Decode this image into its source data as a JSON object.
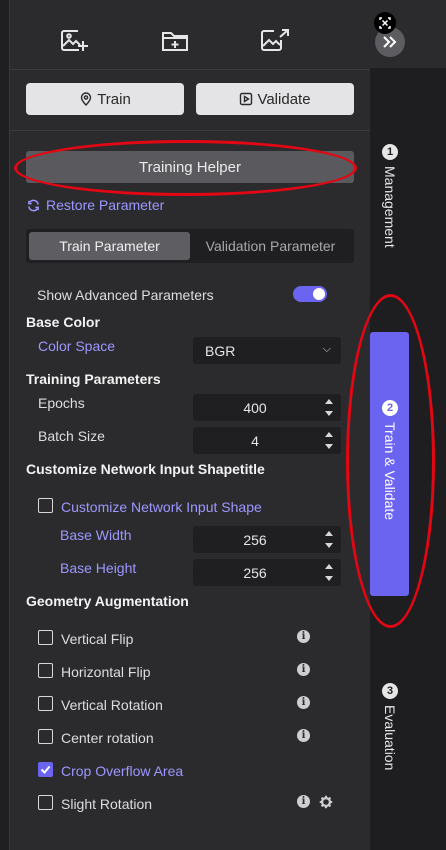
{
  "toolbar": {
    "icons": [
      "add-image-icon",
      "add-folder-icon",
      "export-image-icon"
    ]
  },
  "actions": {
    "train_label": "Train",
    "validate_label": "Validate"
  },
  "helper": {
    "label": "Training Helper"
  },
  "restore": {
    "label": "Restore Parameter"
  },
  "tabs": {
    "train": "Train Parameter",
    "validation": "Validation Parameter",
    "active": "train"
  },
  "advanced": {
    "label": "Show Advanced Parameters",
    "enabled": true
  },
  "base_color": {
    "title": "Base Color",
    "color_space_label": "Color Space",
    "color_space_value": "BGR"
  },
  "training": {
    "title": "Training Parameters",
    "epochs_label": "Epochs",
    "epochs_value": "400",
    "batch_label": "Batch Size",
    "batch_value": "4"
  },
  "shape": {
    "title": "Customize Network Input Shapetitle",
    "checkbox_label": "Customize Network Input Shape",
    "checked": false,
    "width_label": "Base Width",
    "width_value": "256",
    "height_label": "Base Height",
    "height_value": "256"
  },
  "geometry": {
    "title": "Geometry Augmentation",
    "items": [
      {
        "label": "Vertical Flip",
        "checked": false
      },
      {
        "label": "Horizontal Flip",
        "checked": false
      },
      {
        "label": "Vertical Rotation",
        "checked": false
      },
      {
        "label": "Center rotation",
        "checked": false
      },
      {
        "label": "Crop Overflow Area",
        "checked": true
      },
      {
        "label": "Slight Rotation",
        "checked": false
      }
    ]
  },
  "rail": {
    "tabs": [
      {
        "num": "1",
        "label": "Management"
      },
      {
        "num": "2",
        "label": "Train & Validate"
      },
      {
        "num": "3",
        "label": "Evaluation"
      }
    ],
    "active": "2"
  },
  "colors": {
    "accent": "#6b64f0",
    "link": "#9d97ff",
    "annotation": "#e30613"
  }
}
